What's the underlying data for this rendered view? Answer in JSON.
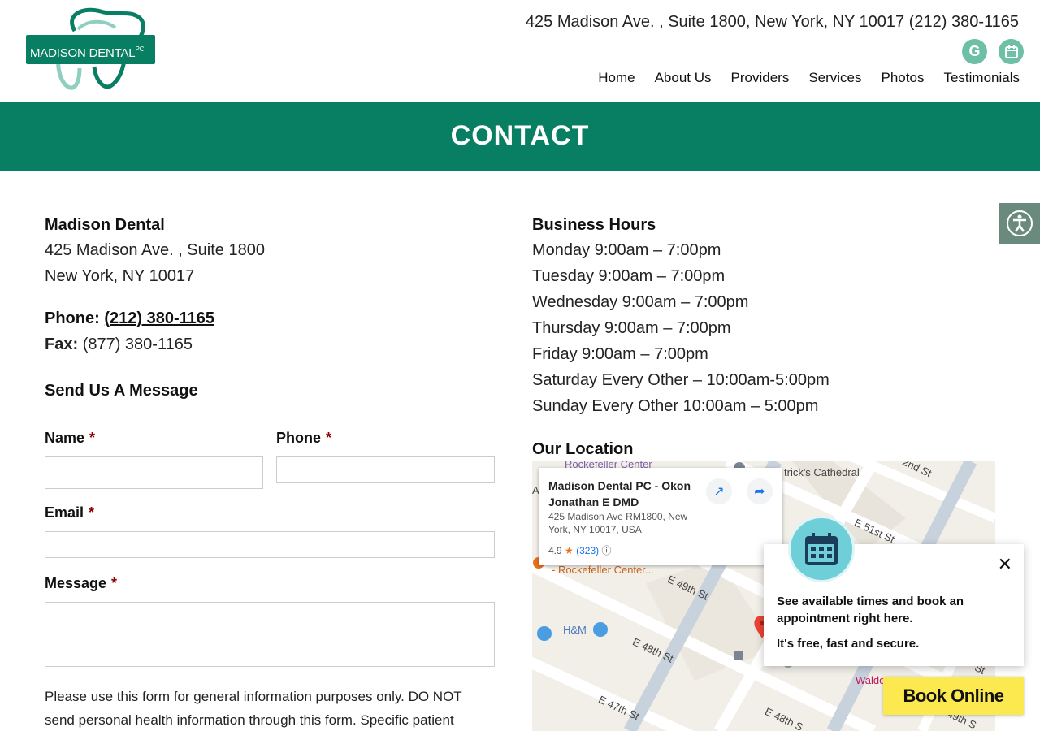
{
  "header": {
    "logo_text": "MADISON DENTAL",
    "logo_suffix": "PC",
    "contact_line": "425 Madison Ave. , Suite 1800, New York, NY 10017 (212) 380-1165",
    "nav": [
      "Home",
      "About Us",
      "Providers",
      "Services",
      "Photos",
      "Testimonials"
    ],
    "icons": [
      "google-icon",
      "calendar-icon"
    ]
  },
  "banner": {
    "title": "CONTACT"
  },
  "contact": {
    "name": "Madison Dental",
    "address_line1": "425 Madison Ave. , Suite 1800",
    "address_line2": "New York, NY 10017",
    "phone_label": "Phone:",
    "phone": "(212) 380-1165",
    "fax_label": "Fax:",
    "fax": "(877) 380-1165"
  },
  "form": {
    "title": "Send Us A Message",
    "name_label": "Name",
    "phone_label": "Phone",
    "email_label": "Email",
    "message_label": "Message",
    "required_marker": "*",
    "notice": "Please use this form for general information purposes only. DO NOT send personal health information through this form. Specific patient"
  },
  "hours": {
    "title": "Business Hours",
    "items": [
      "Monday 9:00am – 7:00pm",
      "Tuesday 9:00am – 7:00pm",
      "Wednesday 9:00am – 7:00pm",
      "Thursday 9:00am – 7:00pm",
      "Friday 9:00am – 7:00pm",
      "Saturday Every Other – 10:00am-5:00pm",
      "Sunday Every Other 10:00am – 5:00pm"
    ]
  },
  "location": {
    "title": "Our Location",
    "card_title": "Madison Dental PC - Okon Jonathan E DMD",
    "card_address": "425 Madison Ave RM1800, New York, NY 10017, USA",
    "rating": "4.9",
    "review_count": "(323)",
    "labels": {
      "cathedral": "trick's Cathedral",
      "rockefeller_top": "Rockefeller Center",
      "rockefeller": "- Rockefeller Center...",
      "e51": "E 51st St",
      "e49": "E 49th St",
      "e48": "E 48th St",
      "e48b": "E 48th S",
      "e47": "E 47th St",
      "hm": "H&M",
      "waldo": "Waldo",
      "n2": "2nd St",
      "e49b": "49th S",
      "ab": "Ab",
      "st": "St"
    }
  },
  "booking": {
    "text": "See available times and book an appointment right here.",
    "sub": "It's free, fast and secure.",
    "button": "Book Online"
  },
  "colors": {
    "brand_green": "#087f62",
    "social_green": "#6dbfa5",
    "book_yellow": "#fce94f"
  }
}
